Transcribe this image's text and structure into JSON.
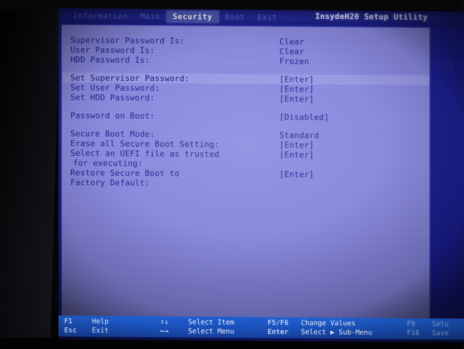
{
  "app": {
    "title": "InsydeH20 Setup Utility"
  },
  "menu": {
    "items": [
      {
        "label": "Information",
        "active": false
      },
      {
        "label": "Main",
        "active": false
      },
      {
        "label": "Security",
        "active": true
      },
      {
        "label": "Boot",
        "active": false
      },
      {
        "label": "Exit",
        "active": false
      }
    ]
  },
  "main": {
    "status_rows": [
      {
        "label": "Supervisor Password Is:",
        "value": "Clear"
      },
      {
        "label": "User Password Is:",
        "value": "Clear"
      },
      {
        "label": "HDD Password Is:",
        "value": "Frozen"
      }
    ],
    "set_rows": [
      {
        "label": "Set Supervisor Password:",
        "value": "[Enter]",
        "selected": true
      },
      {
        "label": "Set User Password:",
        "value": "[Enter]",
        "selected": false
      },
      {
        "label": "Set HDD Password:",
        "value": "[Enter]",
        "selected": false
      }
    ],
    "boot_rows": [
      {
        "label": "Password on Boot:",
        "value": "[Disabled]"
      }
    ],
    "secure_rows": [
      {
        "label": "Secure Boot Mode:",
        "value": "Standard"
      },
      {
        "label": "Erase all Secure Boot Setting:",
        "value": "[Enter]"
      },
      {
        "label": "Select an UEFI file as trusted",
        "value": "[Enter]"
      },
      {
        "label": "for executing:",
        "value": ""
      },
      {
        "label": "Restore Secure Boot to",
        "value": "[Enter]"
      },
      {
        "label": "Factory Default:",
        "value": ""
      }
    ]
  },
  "help_panel": {
    "visible_fragment": "S\nth\nto\nen"
  },
  "statusbar": {
    "col1": [
      {
        "key": "F1",
        "text": "Help"
      },
      {
        "key": "Esc",
        "text": "Exit"
      }
    ],
    "col2": [
      {
        "key": "↑↓",
        "text": "Select Item"
      },
      {
        "key": "←→",
        "text": "Select Menu"
      }
    ],
    "col3": [
      {
        "key": "F5/F6",
        "text": "Change Values"
      },
      {
        "key": "Enter",
        "text": "Select ▶ Sub-Menu"
      }
    ],
    "col4": [
      {
        "key": "F9",
        "text": "Setu"
      },
      {
        "key": "F10",
        "text": "Save"
      }
    ]
  },
  "colors": {
    "screen_bg": "#1b1f8e",
    "panel_bg": "#8f8fe2",
    "text": "#1a1e86",
    "titlebar": "#20258f",
    "tab_active_bg": "#4a53a8",
    "statusbar_bg": "#1b51bb",
    "bezel": "#0a0a0d"
  }
}
